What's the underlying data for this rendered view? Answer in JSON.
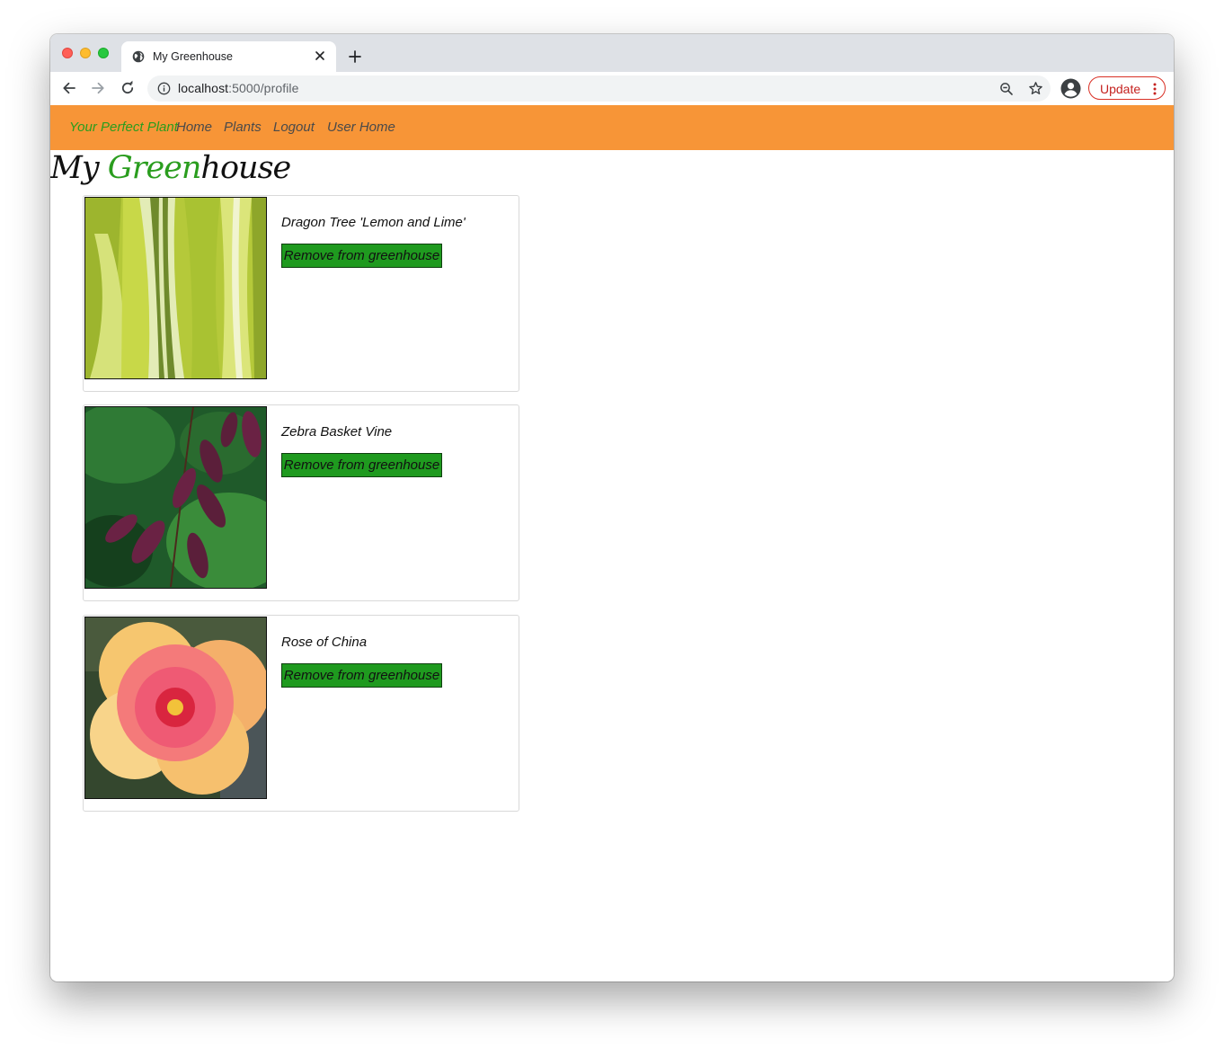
{
  "browser": {
    "tab_title": "My Greenhouse",
    "url_host": "localhost",
    "url_path": ":5000/profile",
    "update_label": "Update"
  },
  "navbar": {
    "brand": "Your Perfect Plant",
    "links": [
      "Home",
      "Plants",
      "Logout",
      "User Home"
    ],
    "background": "#f79537",
    "brand_color": "#2a9d1e"
  },
  "page": {
    "title_part1": "My ",
    "title_green": "Green",
    "title_part2": "house"
  },
  "plants": [
    {
      "name": "Dragon Tree 'Lemon and Lime'",
      "button": "Remove from greenhouse",
      "image": "dracaena-leaves"
    },
    {
      "name": "Zebra Basket Vine",
      "button": "Remove from greenhouse",
      "image": "speckled-vine-leaves"
    },
    {
      "name": "Rose of China",
      "button": "Remove from greenhouse",
      "image": "pink-hibiscus-flower"
    }
  ],
  "colors": {
    "button_green": "#1f9a1f",
    "update_red": "#d93025"
  }
}
